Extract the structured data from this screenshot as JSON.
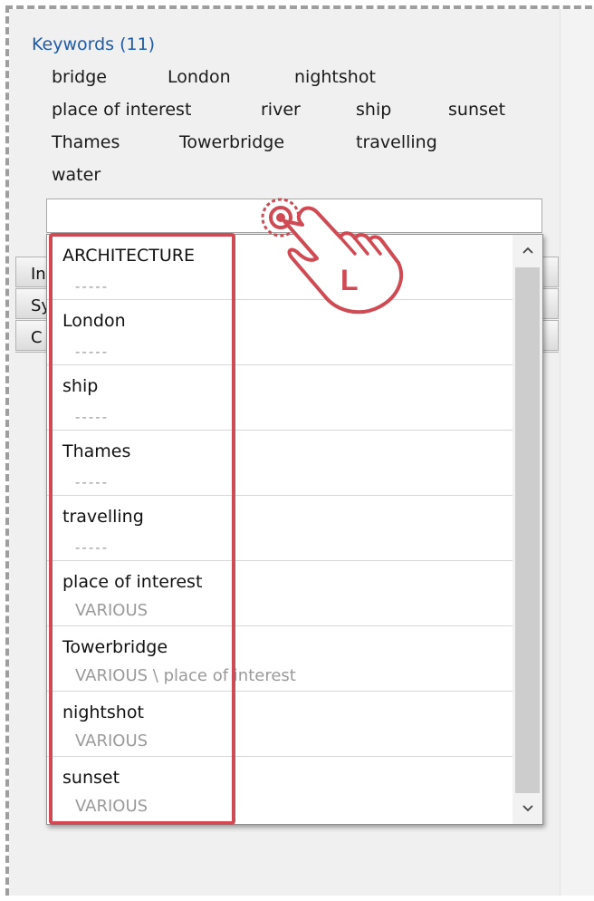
{
  "keywords": {
    "header": "Keywords (11)",
    "items": [
      "bridge",
      "London",
      "nightshot",
      "place of interest",
      "river",
      "ship",
      "sunset",
      "Thames",
      "Towerbridge",
      "travelling",
      "water"
    ],
    "input_value": ""
  },
  "sections": {
    "rows": [
      "In",
      "Sy",
      "C"
    ]
  },
  "dropdown": {
    "items": [
      {
        "name": "ARCHITECTURE",
        "path": "-----"
      },
      {
        "name": "London",
        "path": "-----"
      },
      {
        "name": "ship",
        "path": "-----"
      },
      {
        "name": "Thames",
        "path": "-----"
      },
      {
        "name": "travelling",
        "path": "-----"
      },
      {
        "name": "place of interest",
        "path": "VARIOUS"
      },
      {
        "name": "Towerbridge",
        "path": "VARIOUS \\ place of interest"
      },
      {
        "name": "nightshot",
        "path": "VARIOUS"
      },
      {
        "name": "sunset",
        "path": "VARIOUS"
      }
    ]
  },
  "annotation": {
    "gesture_letter": "L",
    "highlight_color": "#d04a53"
  },
  "icons": [
    "tap-hand-icon",
    "chevron-up-icon",
    "chevron-down-icon"
  ]
}
